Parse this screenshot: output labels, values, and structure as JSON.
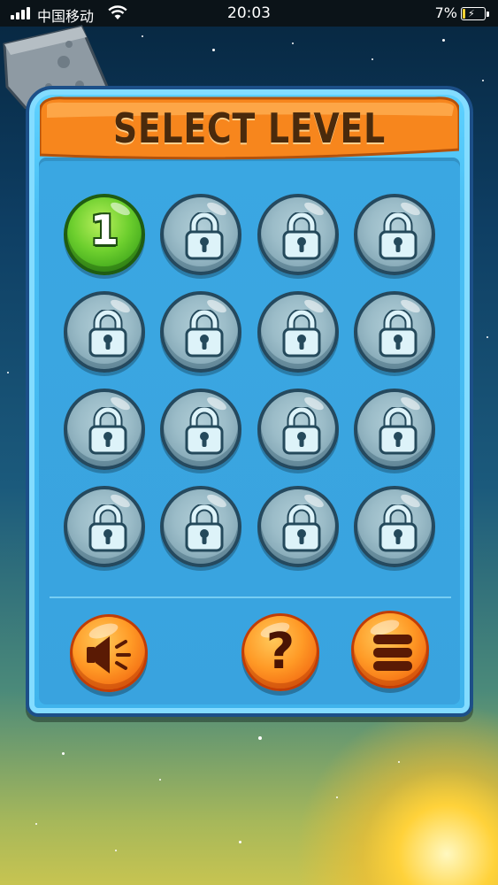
{
  "status_bar": {
    "carrier": "中国移动",
    "time": "20:03",
    "battery": "7%",
    "battery_level": 0.07
  },
  "title": "SELECT LEVEL",
  "levels": [
    {
      "label": "1",
      "locked": false
    },
    {
      "label": "",
      "locked": true
    },
    {
      "label": "",
      "locked": true
    },
    {
      "label": "",
      "locked": true
    },
    {
      "label": "",
      "locked": true
    },
    {
      "label": "",
      "locked": true
    },
    {
      "label": "",
      "locked": true
    },
    {
      "label": "",
      "locked": true
    },
    {
      "label": "",
      "locked": true
    },
    {
      "label": "",
      "locked": true
    },
    {
      "label": "",
      "locked": true
    },
    {
      "label": "",
      "locked": true
    },
    {
      "label": "",
      "locked": true
    },
    {
      "label": "",
      "locked": true
    },
    {
      "label": "",
      "locked": true
    },
    {
      "label": "",
      "locked": true
    }
  ],
  "controls": {
    "sound_icon": "speaker-icon",
    "help_label": "?",
    "menu_icon": "menu-icon"
  },
  "colors": {
    "banner_orange": "#f7861d",
    "panel_blue": "#3fb3ec",
    "unlocked_green": "#5cc72a",
    "locked_grey": "#9bbcc8",
    "button_orange": "#ff9a26"
  }
}
